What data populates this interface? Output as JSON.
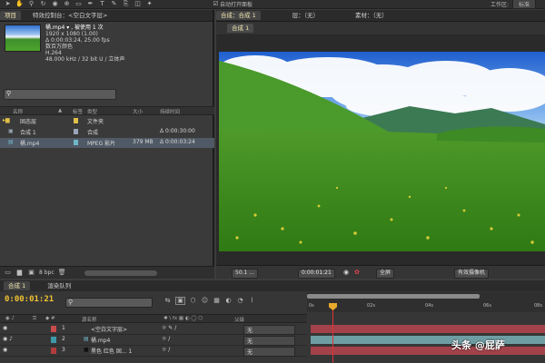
{
  "toolbar": {
    "snap_label": "自动打开面板",
    "workspace_label": "工作区:",
    "workspace_value": "标准"
  },
  "panel_tabs": {
    "project_tab": "项目",
    "effects_tab": "特效控制台：<空白文字层>",
    "comp_tab": "合成：合成 1",
    "layer_tab": "层：（无）",
    "footage_tab": "素材：（无）",
    "comp_subtab": "合成 1"
  },
  "project": {
    "file_name": "桶.mp4 ▾ , 被使用 1 次",
    "info_lines": [
      "1920 x 1080 (1.00)",
      "Δ 0:00:03:24, 25.00 fps",
      "数百万颜色",
      "H.264",
      "48.000 kHz / 32 bit U / 立体声"
    ],
    "columns": [
      "名称",
      "▲",
      "标签",
      "类型",
      "大小",
      "持续时间"
    ],
    "items": [
      {
        "name": "固态层",
        "type": "文件夹",
        "size": "",
        "duration": "",
        "color": "#e0c04a",
        "icon": "folder-icon"
      },
      {
        "name": "合成 1",
        "type": "合成",
        "size": "",
        "duration": "Δ 0:00:30:00",
        "color": "#9aa6b8",
        "icon": "composition-icon"
      },
      {
        "name": "桶.mp4",
        "type": "MPEG 影片",
        "size": "379 MB",
        "duration": "Δ 0:00:03:24",
        "color": "#6fb7c9",
        "icon": "video-file-icon"
      }
    ],
    "bpc": "8 bpc"
  },
  "comp_footer": {
    "zoom": "50.1 ...",
    "timecode": "0:00:01:21",
    "resolution": "全屏",
    "camera": "有效摄像机"
  },
  "timeline": {
    "tabs": [
      "合成 1",
      "渲染队列"
    ],
    "timecode": "0:00:01:21",
    "search_placeholder": "",
    "ruler_labels": [
      "0s",
      "02s",
      "04s",
      "06s",
      "08s"
    ],
    "column_source": "源名称",
    "column_parent": "父级",
    "layers": [
      {
        "index": "1",
        "name": "<空白文字层>",
        "color": "#c94b4b",
        "bar_color": "#a3424a",
        "mode": "无"
      },
      {
        "index": "2",
        "name": "桶.mp4",
        "color": "#3e9aa8",
        "bar_color": "#6e9ea4",
        "mode": "无"
      },
      {
        "index": "3",
        "name": "黑色 红色 固... 1",
        "color": "#b23c3c",
        "bar_color": "#a3424a",
        "mode": "无"
      }
    ]
  },
  "watermark": "头条 @屁萨"
}
